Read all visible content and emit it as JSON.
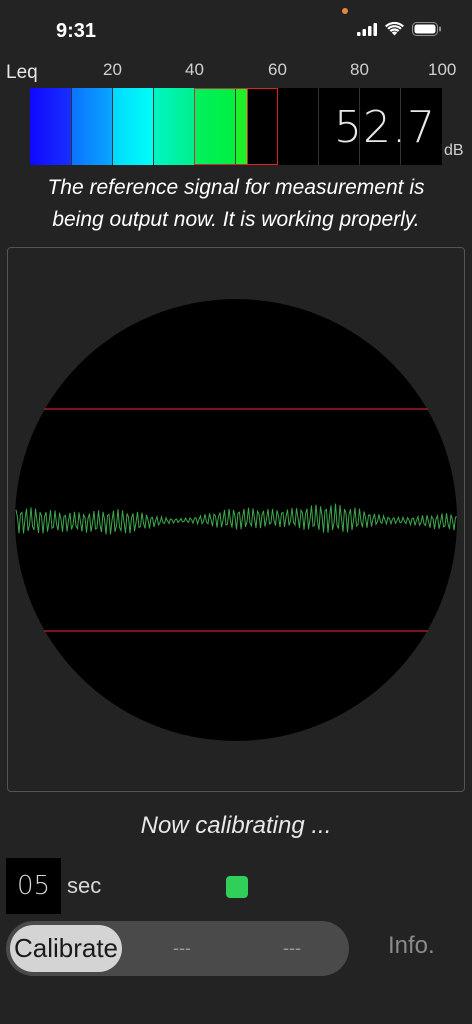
{
  "status_bar": {
    "time": "9:31"
  },
  "scale": {
    "leq_label": "Leq",
    "ticks": [
      "20",
      "40",
      "60",
      "80",
      "100"
    ]
  },
  "meter": {
    "value": "52.7",
    "unit": "dB",
    "level": 52.7,
    "range": [
      0,
      100
    ]
  },
  "message": {
    "line1": "The reference signal for measurement is",
    "line2": "being output now.  It is working properly."
  },
  "calibration": {
    "status": "Now calibrating ...",
    "seconds": "05",
    "seconds_unit": "sec",
    "indicator_color": "#2fcf5a"
  },
  "controls": {
    "calibrate_label": "Calibrate",
    "slot2_label": "---",
    "slot3_label": "---",
    "info_label": "Info."
  },
  "colors": {
    "background": "#232323",
    "waveform": "#3ea84e",
    "limit_line": "#c0202a"
  }
}
